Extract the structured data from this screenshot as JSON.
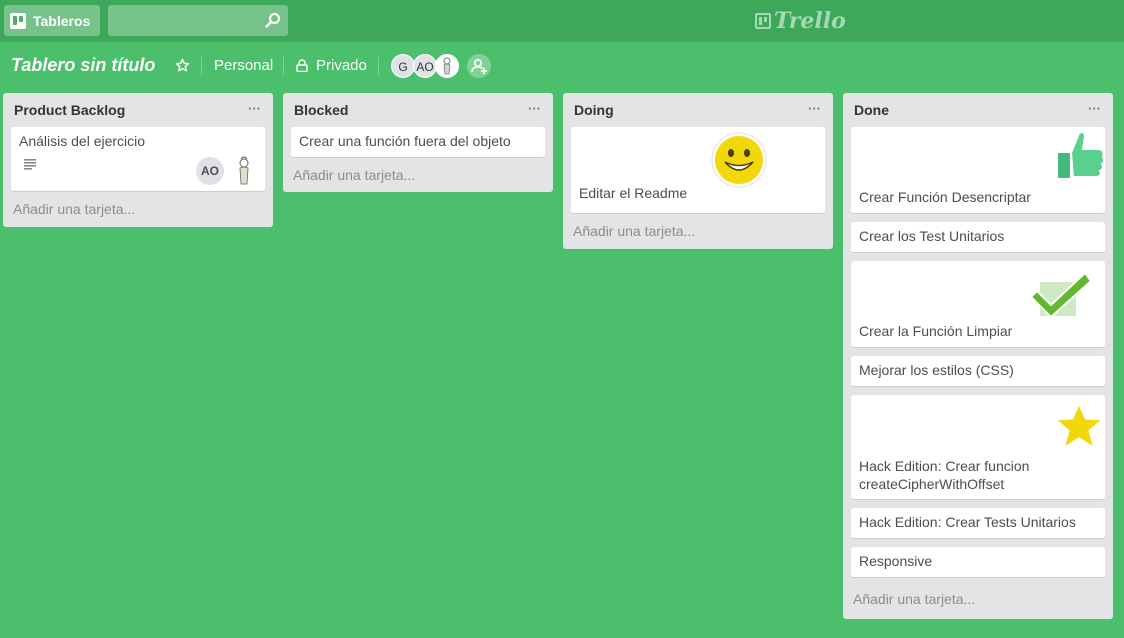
{
  "topbar": {
    "boards_label": "Tableros",
    "search_placeholder": "",
    "logo_text": "Trello"
  },
  "board": {
    "title": "Tablero sin título",
    "team": "Personal",
    "visibility": "Privado",
    "members": [
      "G",
      "AO"
    ]
  },
  "colors": {
    "background": "#4bbf6b",
    "topbar": "#3da85a",
    "list": "#e2e4e6"
  },
  "lists": [
    {
      "name": "Product Backlog",
      "menu": "···",
      "add_card": "Añadir una tarjeta...",
      "cards": [
        {
          "title": "Análisis del ejercicio",
          "has_description": true,
          "member": "AO"
        }
      ]
    },
    {
      "name": "Blocked",
      "menu": "···",
      "add_card": "Añadir una tarjeta...",
      "cards": [
        {
          "title": "Crear una función fuera del objeto"
        }
      ]
    },
    {
      "name": "Doing",
      "menu": "···",
      "add_card": "Añadir una tarjeta...",
      "cards": [
        {
          "title": "Editar el Readme",
          "sticker": "smiley-sticker"
        }
      ]
    },
    {
      "name": "Done",
      "menu": "···",
      "add_card": "Añadir una tarjeta...",
      "cards": [
        {
          "title": "Crear Función Desencriptar",
          "sticker": "thumbs-up-sticker"
        },
        {
          "title": "Crear los Test Unitarios"
        },
        {
          "title": "Crear la Función Limpiar",
          "sticker": "check-sticker"
        },
        {
          "title": "Mejorar los estilos (CSS)"
        },
        {
          "title": "Hack Edition: Crear funcion createCipherWithOffset",
          "sticker": "star-sticker"
        },
        {
          "title": "Hack Edition: Crear Tests Unitarios"
        },
        {
          "title": "Responsive"
        }
      ]
    }
  ]
}
